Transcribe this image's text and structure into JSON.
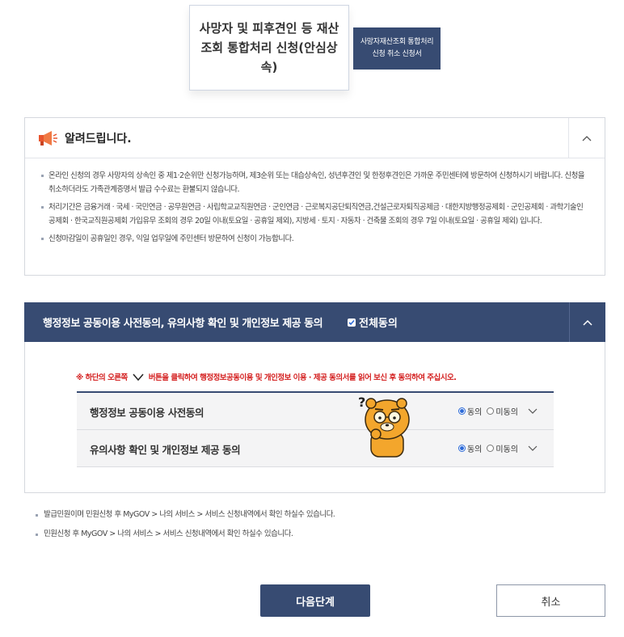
{
  "tabs": {
    "active": "사망자 및 피후견인 등 재산조회 통합처리 신청(안심상속)",
    "cancel_tab": "사망자재산조회 통합처리 신청 취소 신청서"
  },
  "notice": {
    "title": "알려드립니다.",
    "items": [
      "온라인 신청의 경우 사망자의 상속인 중 제1·2순위만 신청가능하며, 제3순위 또는 대습상속인, 성년후견인 및 한정후견인은 가까운 주민센터에 방문하여 신청하시기 바랍니다. 신청을 취소하더라도 가족관계증명서 발급 수수료는 환불되지 않습니다.",
      "처리기간은 금융거래 · 국세 · 국민연금 · 공무원연금 · 사립학교교직원연금 · 군인연금 · 근로복지공단퇴직연금,건설근로자퇴직공제금 · 대한지방행정공제회 · 군인공제회 · 과학기술인공제회 · 한국교직원공제회 가입유무 조회의 경우 20일 이내(토요일 · 공휴일 제외), 지방세 · 토지 · 자동차 · 건축물 조회의 경우 7일 이내(토요일 · 공휴일 제외) 입니다.",
      "신청마감일이 공휴일인 경우, 익일 업무일에 주민센터 방문하여 신청이 가능합니다."
    ]
  },
  "consent": {
    "title": "행정정보 공동이용 사전동의, 유의사항 확인 및 개인정보 제공 동의",
    "all_agree": "전체동의",
    "warning_prefix": "※ 하단의 오른쪽",
    "warning_suffix": "버튼을 클릭하여 행정정보공동이용 및 개인정보 이용 · 제공 동의서를 읽어 보신 후 동의하여 주십시오.",
    "rows": [
      {
        "label": "행정정보 공동이용 사전동의",
        "agree": "동의",
        "disagree": "미동의",
        "selected": "동의"
      },
      {
        "label": "유의사항 확인 및 개인정보 제공 동의",
        "agree": "동의",
        "disagree": "미동의",
        "selected": "동의"
      }
    ]
  },
  "notes": [
    "발급민원이며 민원신청 후 MyGOV > 나의 서비스 > 서비스 신청내역에서 확인 하실수 있습니다.",
    "민원신청 후 MyGOV > 나의 서비스 > 서비스 신청내역에서 확인 하실수 있습니다."
  ],
  "buttons": {
    "next": "다음단계",
    "cancel": "취소"
  },
  "colors": {
    "navy": "#374b72",
    "warning_red": "#d42020",
    "radio_blue": "#2c6ad8"
  }
}
